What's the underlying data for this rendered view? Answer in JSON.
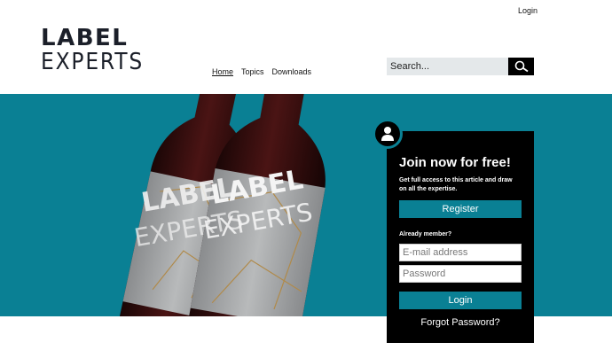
{
  "header": {
    "login_link": "Login",
    "logo": {
      "line1": "LABEL",
      "line2": "EXPERTS"
    },
    "nav": [
      {
        "label": "Home",
        "active": true
      },
      {
        "label": "Topics",
        "active": false
      },
      {
        "label": "Downloads",
        "active": false
      }
    ],
    "search": {
      "placeholder": "Search...",
      "icon": "search-icon"
    }
  },
  "hero": {
    "background_color": "#0a8094",
    "bottle_label": {
      "line1": "LABEL",
      "line2": "EXPERTS"
    }
  },
  "signup": {
    "icon": "user-icon",
    "title": "Join now for free!",
    "description": "Get full access to this article and draw on all the expertise.",
    "register_label": "Register",
    "member_label": "Already member?",
    "email_placeholder": "E-mail address",
    "password_placeholder": "Password",
    "login_label": "Login",
    "forgot_label": "Forgot Password?"
  }
}
